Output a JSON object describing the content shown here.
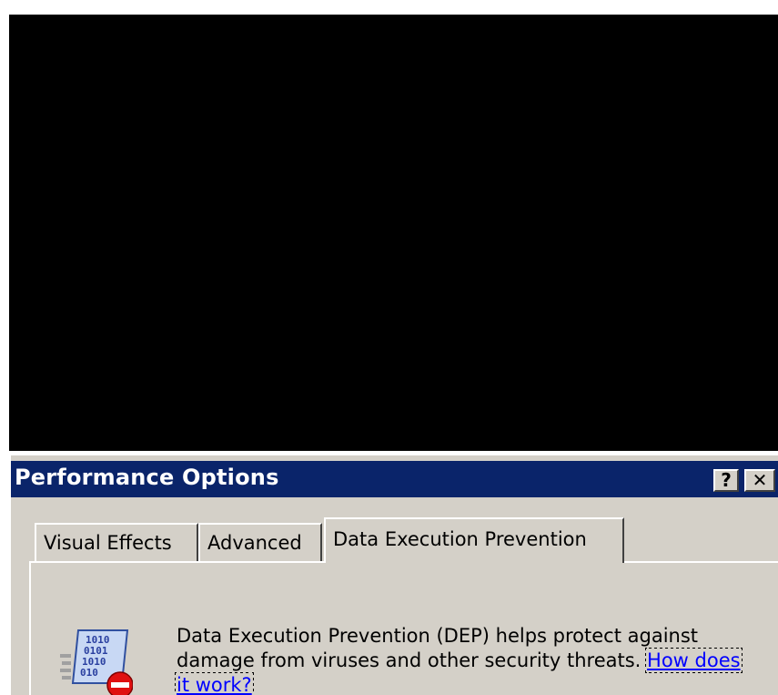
{
  "window": {
    "title": "Performance Options",
    "help_button": "?",
    "close_button": "✕"
  },
  "tabs": [
    {
      "label": "Visual Effects",
      "selected": false
    },
    {
      "label": "Advanced",
      "selected": false
    },
    {
      "label": "Data Execution Prevention",
      "selected": true
    }
  ],
  "dep": {
    "description": "Data Execution Prevention (DEP) helps protect against damage from viruses and other security threats.",
    "link": "How does it work?",
    "icon": "binary-document-stop-icon"
  },
  "colors": {
    "titlebar": "#0a246a",
    "dialog_face": "#d4d0c8",
    "link": "#0000ff"
  }
}
